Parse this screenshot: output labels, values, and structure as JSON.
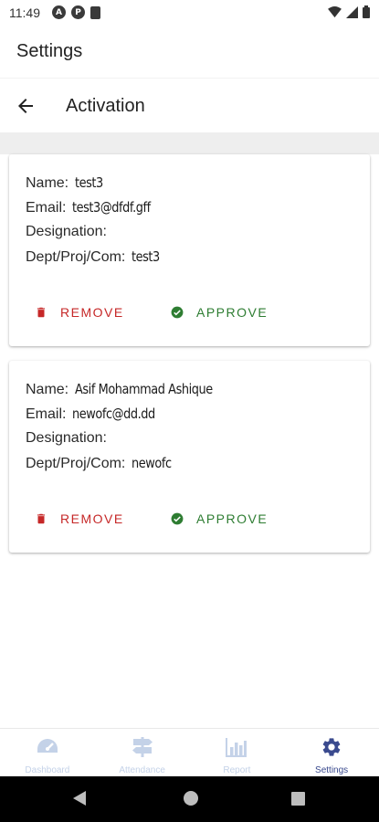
{
  "status_bar": {
    "time": "11:49",
    "left_icons": [
      "A",
      "P"
    ],
    "right_icons": [
      "wifi-icon",
      "signal-icon",
      "battery-icon"
    ]
  },
  "app_bar": {
    "title": "Settings"
  },
  "sub_header": {
    "title": "Activation",
    "back_icon": "back-arrow-icon"
  },
  "labels": {
    "name": "Name:",
    "email": "Email:",
    "designation": "Designation:",
    "dept": "Dept/Proj/Com:",
    "remove": "REMOVE",
    "approve": "APPROVE"
  },
  "requests": [
    {
      "name": "test3",
      "email": "test3@dfdf.gff",
      "designation": "",
      "dept": "test3"
    },
    {
      "name": "Asif Mohammad Ashique",
      "email": "newofc@dd.dd",
      "designation": "",
      "dept": "newofc"
    }
  ],
  "bottom_nav": {
    "items": [
      {
        "label": "Dashboard",
        "icon": "speedometer-icon",
        "active": false
      },
      {
        "label": "Attendance",
        "icon": "signpost-icon",
        "active": false
      },
      {
        "label": "Report",
        "icon": "bar-chart-icon",
        "active": false
      },
      {
        "label": "Settings",
        "icon": "gear-icon",
        "active": true
      }
    ]
  },
  "colors": {
    "remove": "#c62828",
    "approve": "#2e7d32",
    "nav_active": "#3a4a8e",
    "nav_inactive": "#c4d2e8"
  }
}
